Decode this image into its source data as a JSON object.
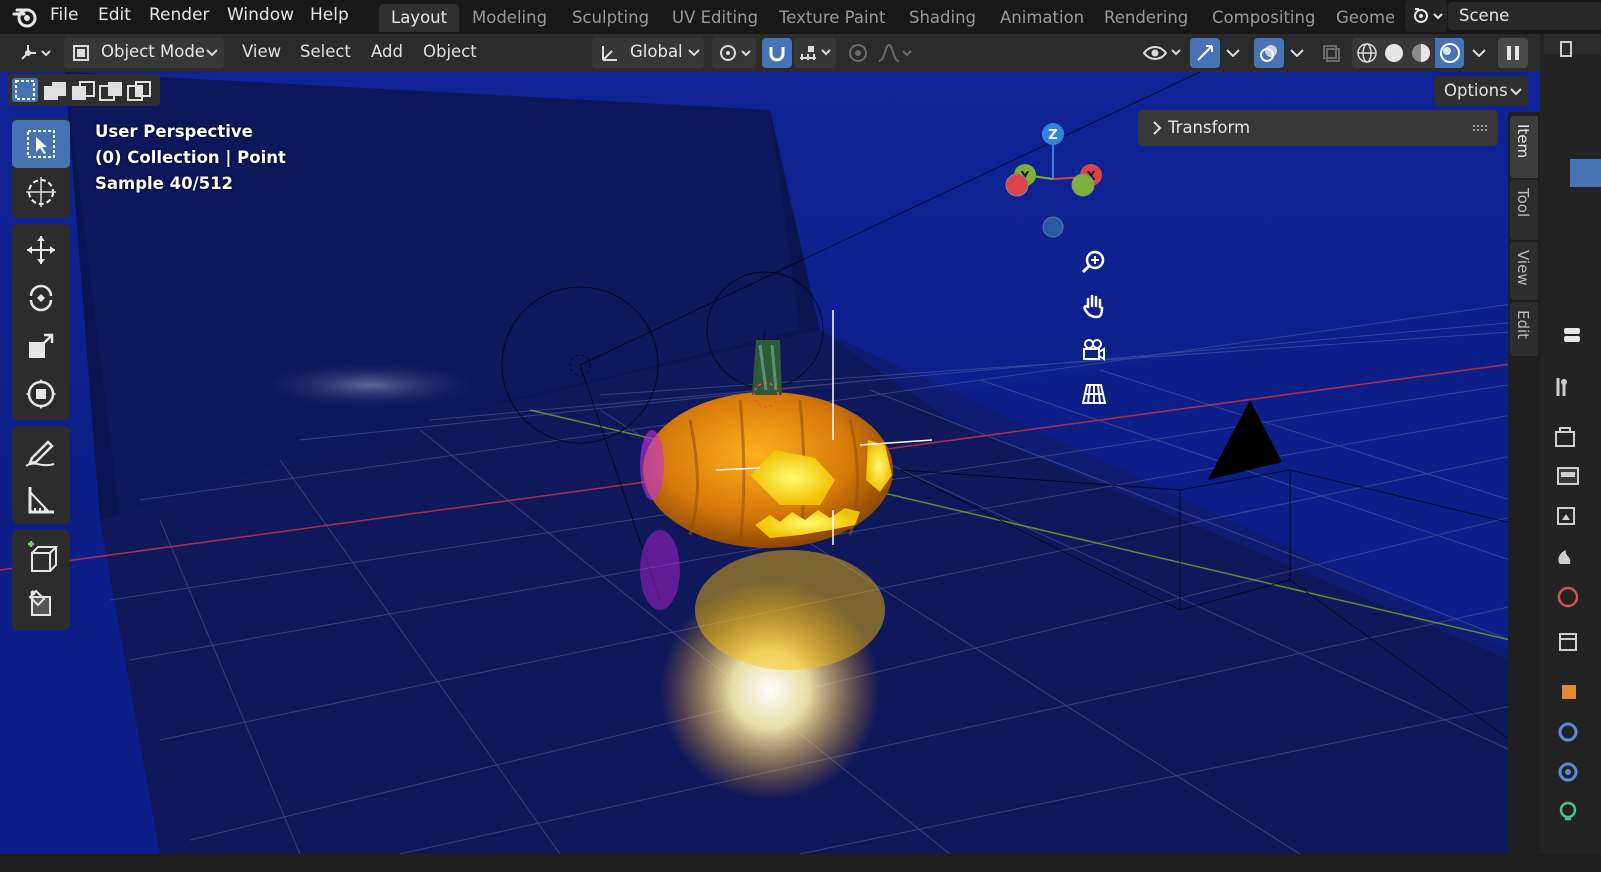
{
  "app": {
    "logo_icon": "blender-logo-icon"
  },
  "menubar": {
    "items": [
      "File",
      "Edit",
      "Render",
      "Window",
      "Help"
    ]
  },
  "workspaces": {
    "tabs": [
      "Layout",
      "Modeling",
      "Sculpting",
      "UV Editing",
      "Texture Paint",
      "Shading",
      "Animation",
      "Rendering",
      "Compositing",
      "Geometry Nodes"
    ],
    "active": "Layout"
  },
  "scene": {
    "name": "Scene",
    "icon": "scene-icon"
  },
  "header": {
    "mode": "Object Mode",
    "menus": [
      "View",
      "Select",
      "Add",
      "Object"
    ],
    "orientation": "Global",
    "options_label": "Options"
  },
  "overlay": {
    "line1": "User Perspective",
    "line2": "(0) Collection | Point",
    "line3": "Sample 40/512"
  },
  "transform_panel": {
    "label": "Transform"
  },
  "sidebar_tabs": [
    "Item",
    "Tool",
    "View",
    "Edit"
  ],
  "gizmo": {
    "z": "Z",
    "y": "Y",
    "x": "X"
  },
  "colors": {
    "accent": "#4772b3",
    "viewport_bg": "#0b1f84",
    "pumpkin": "#e58a10",
    "axis_x": "#d8454e",
    "axis_y": "#7fb03a",
    "axis_z": "#2f84e3"
  }
}
